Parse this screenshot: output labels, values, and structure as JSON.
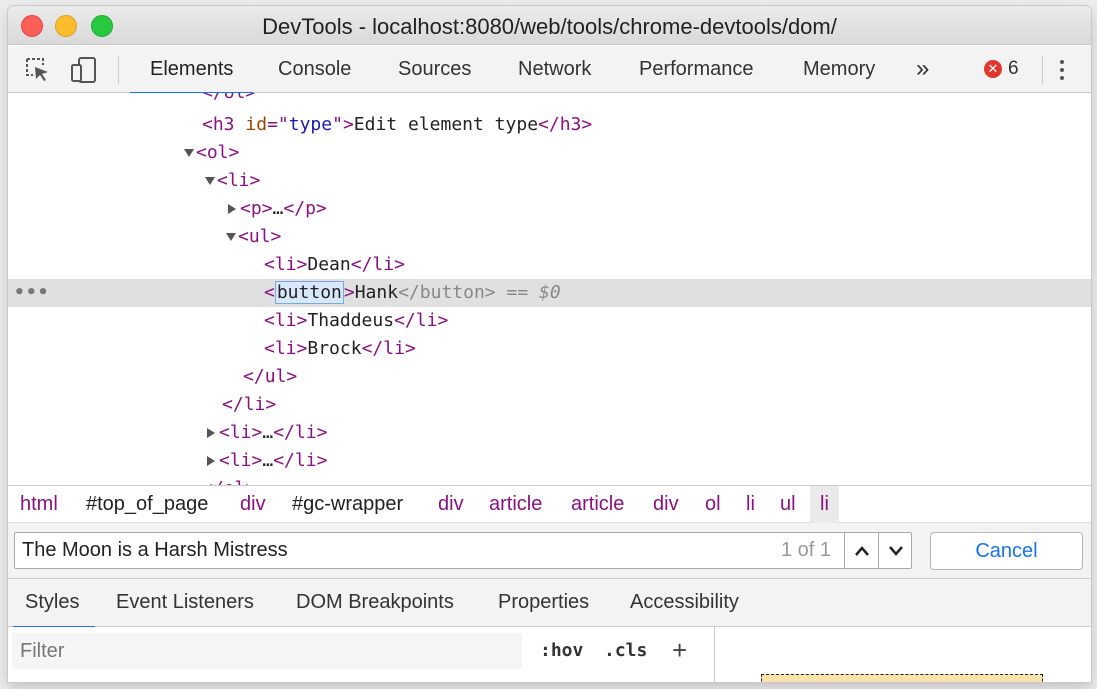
{
  "window": {
    "title": "DevTools - localhost:8080/web/tools/chrome-devtools/dom/"
  },
  "toolbar": {
    "tabs": [
      "Elements",
      "Console",
      "Sources",
      "Network",
      "Performance",
      "Memory"
    ],
    "more": "»",
    "error_count": "6"
  },
  "dom": {
    "h3": {
      "tag": "h3",
      "attr_name": "id",
      "attr_value": "type",
      "text": "Edit element type"
    },
    "ol": "ol",
    "li": "li",
    "p": "p",
    "ul": "ul",
    "ellipsis": "…",
    "items": {
      "dean": "Dean",
      "hank": "Hank",
      "thaddeus": "Thaddeus",
      "brock": "Brock"
    },
    "editing_tag": "button",
    "closing_tag": "button",
    "selected_marker": "== $0",
    "row_menu": "•••"
  },
  "breadcrumbs": [
    "html",
    "#top_of_page",
    "div",
    "#gc-wrapper",
    "div",
    "article",
    "article",
    "div",
    "ol",
    "li",
    "ul",
    "li"
  ],
  "search": {
    "query": "The Moon is a Harsh Mistress",
    "count": "1 of 1",
    "cancel_label": "Cancel"
  },
  "subtabs": [
    "Styles",
    "Event Listeners",
    "DOM Breakpoints",
    "Properties",
    "Accessibility"
  ],
  "styles": {
    "filter_placeholder": "Filter",
    "hov": ":hov",
    "cls": ".cls",
    "add": "+"
  },
  "colors": {
    "accent": "#1a73e8",
    "tag": "#881280",
    "attr": "#994500",
    "value": "#1a1aa6",
    "error": "#e0362e"
  }
}
